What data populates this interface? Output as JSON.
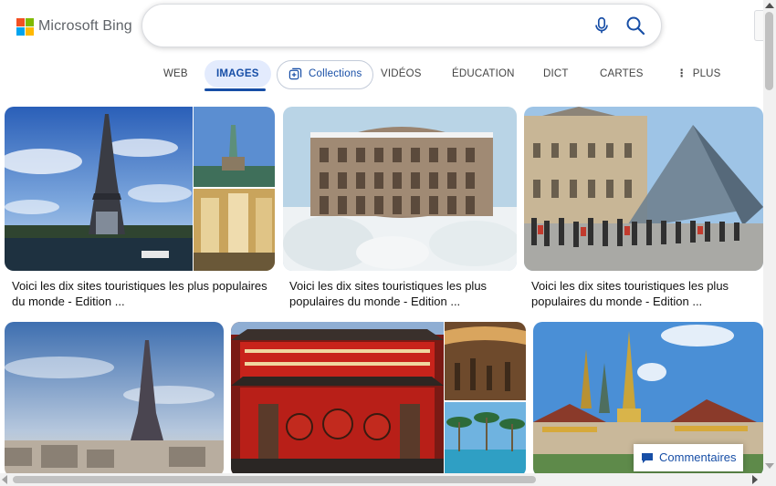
{
  "header": {
    "logo_text": "Microsoft Bing",
    "search_value": ""
  },
  "tabs": {
    "web": "WEB",
    "images": "IMAGES",
    "collections": "Collections",
    "videos": "VIDÉOS",
    "education": "ÉDUCATION",
    "dict": "DICT",
    "maps": "CARTES",
    "more": "PLUS"
  },
  "results": [
    {
      "caption": "Voici les dix sites touristiques les plus populaires du monde - Edition ..."
    },
    {
      "caption": "Voici les dix sites touristiques les plus populaires du monde - Edition ..."
    },
    {
      "caption": "Voici les dix sites touristiques les plus populaires du monde - Edition ..."
    }
  ],
  "feedback": {
    "label": "Commentaires"
  },
  "colors": {
    "accent": "#174ea6",
    "tab_active_bg": "#e3ebfd"
  }
}
